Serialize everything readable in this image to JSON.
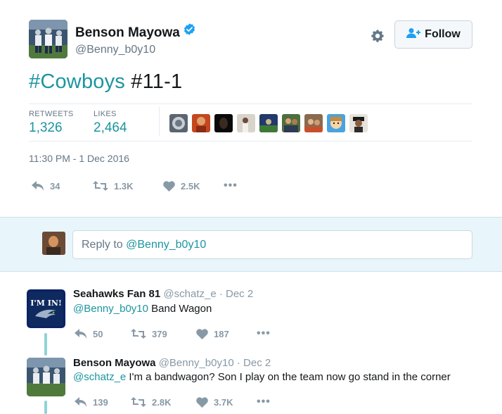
{
  "tweet": {
    "author_name": "Benson Mayowa",
    "author_handle": "@Benny_b0y10",
    "follow_label": "Follow",
    "text_hashtag": "#Cowboys",
    "text_rest": " #11-1",
    "retweets_label": "RETWEETS",
    "retweets_value": "1,326",
    "likes_label": "LIKES",
    "likes_value": "2,464",
    "timestamp": "11:30 PM - 1 Dec 2016",
    "actions": {
      "reply_count": "34",
      "retweet_count": "1.3K",
      "like_count": "2.5K",
      "more": "•••"
    },
    "liker_avatars": [
      "liker-1",
      "liker-2",
      "liker-3",
      "liker-4",
      "liker-5",
      "liker-6",
      "liker-7",
      "liker-8",
      "liker-9",
      "liker-10"
    ]
  },
  "reply_box": {
    "prefix": "Reply to ",
    "mention": "@Benny_b0y10"
  },
  "replies": [
    {
      "name": "Seahawks Fan 81",
      "handle": "@schatz_e",
      "date": "· Dec 2",
      "mention": "@Benny_b0y10",
      "text": " Band Wagon",
      "avatar_text": "I'M IN!",
      "reply_count": "50",
      "retweet_count": "379",
      "like_count": "187",
      "more": "•••"
    },
    {
      "name": "Benson Mayowa",
      "handle": "@Benny_b0y10",
      "date": "· Dec 2",
      "mention": "@schatz_e",
      "text": " I'm a bandwagon? Son I play on the team now go stand in the corner",
      "reply_count": "139",
      "retweet_count": "2.8K",
      "like_count": "3.7K",
      "more": "•••"
    }
  ],
  "colors": {
    "accent": "#1b95a0",
    "verified": "#1da1f2",
    "muted": "#8899a6",
    "reply_bar_bg": "#e8f5fa"
  },
  "icons": [
    "verified-icon",
    "gear-icon",
    "follow-person-icon",
    "reply-icon",
    "retweet-icon",
    "heart-icon",
    "more-icon",
    "seahawks-logo"
  ]
}
